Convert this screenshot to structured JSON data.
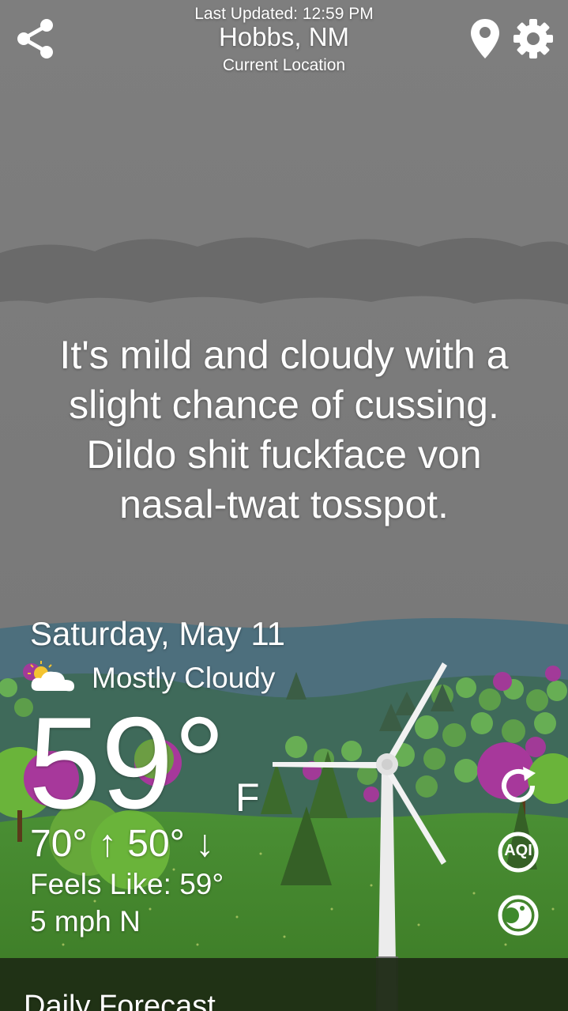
{
  "header": {
    "last_updated": "Last Updated: 12:59 PM",
    "city": "Hobbs, NM",
    "location_label": "Current Location"
  },
  "icons": {
    "share": "share-icon",
    "location": "location-pin-icon",
    "settings": "gear-icon",
    "refresh": "refresh-icon",
    "aqi": "aqi-icon",
    "moon": "moon-icon"
  },
  "message": {
    "lines": [
      "It's mild and cloudy with a",
      "slight chance of cussing.",
      "Dildo shit fuckface von",
      "nasal-twat tosspot."
    ]
  },
  "current": {
    "date": "Saturday, May 11",
    "condition": "Mostly Cloudy",
    "temperature": "59°",
    "unit": "F",
    "high": "70°",
    "high_arrow": "↑",
    "low": "50°",
    "low_arrow": "↓",
    "feels_like": "Feels Like: 59°",
    "wind": "5 mph N"
  },
  "aqi_label": "AQI",
  "footer": {
    "title": "Daily Forecast"
  },
  "colors": {
    "sky": "#7c7c7c",
    "cloud_band": "#6b6b6b",
    "hills_far": "#4b6f7e",
    "hills_mid": "#3e6a58",
    "grass": "#3f8a2c",
    "tree_pink": "#a7389b",
    "footer_bg": "#1d2a14"
  }
}
